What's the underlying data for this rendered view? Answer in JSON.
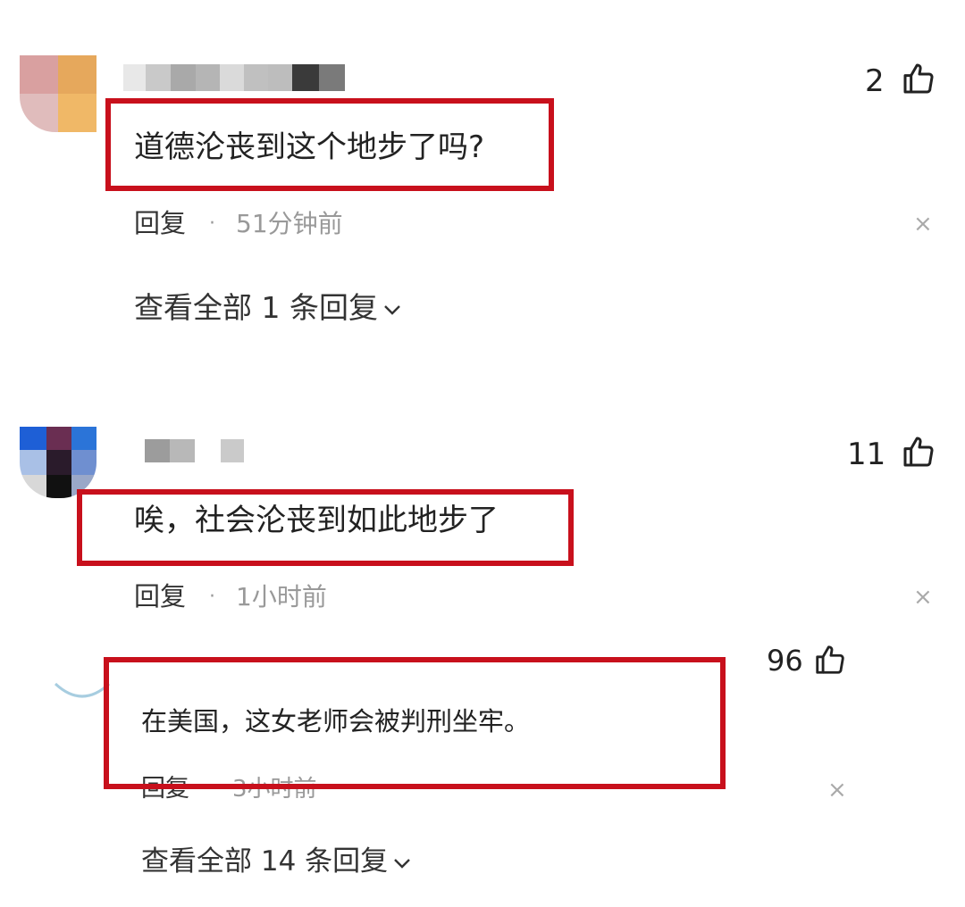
{
  "comments": [
    {
      "likes": "2",
      "text": "道德沦丧到这个地步了吗?",
      "reply_label": "回复",
      "separator": "·",
      "time": "51分钟前",
      "close_symbol": "×",
      "view_replies": "查看全部 1 条回复",
      "icon": "thumbs-up-icon"
    },
    {
      "likes": "11",
      "text": "唉，社会沦丧到如此地步了",
      "reply_label": "回复",
      "separator": "·",
      "time": "1小时前",
      "close_symbol": "×",
      "icon": "thumbs-up-icon"
    },
    {
      "likes": "96",
      "text": "在美国，这女老师会被判刑坐牢。",
      "reply_label": "回复",
      "time": "3小时前",
      "close_symbol": "×",
      "view_replies": "查看全部 14 条回复",
      "icon": "thumbs-up-icon"
    }
  ],
  "colors": {
    "highlight_border": "#c8101c",
    "text": "#222222",
    "muted": "#999999"
  }
}
